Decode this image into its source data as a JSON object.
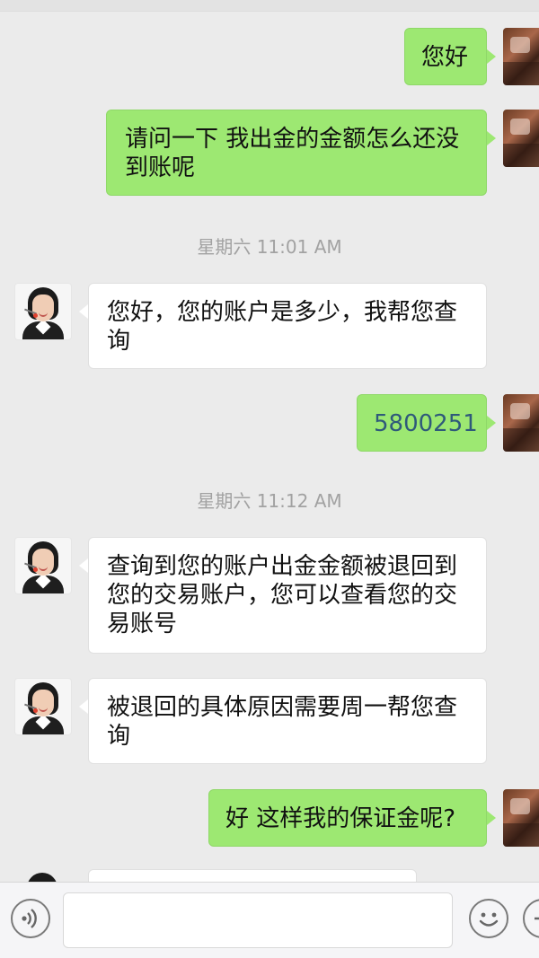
{
  "chat": {
    "messages": [
      {
        "from": "me",
        "text": "您好"
      },
      {
        "from": "me",
        "text": "请问一下 我出金的金额怎么还没到账呢"
      },
      {
        "type": "time",
        "text": "星期六 11:01 AM"
      },
      {
        "from": "agent",
        "text": "您好，您的账户是多少，我帮您查询"
      },
      {
        "from": "me",
        "text": "5800251"
      },
      {
        "type": "time",
        "text": "星期六 11:12 AM"
      },
      {
        "from": "agent",
        "text": "查询到您的账户出金金额被退回到您的交易账户，您可以查看您的交易账号"
      },
      {
        "from": "agent",
        "text": "被退回的具体原因需要周一帮您查询"
      },
      {
        "from": "me",
        "text": "好 这样我的保证金呢?"
      }
    ]
  },
  "input_bar": {
    "text_value": "",
    "icons": [
      "voice-icon",
      "emoji-icon",
      "plus-icon"
    ]
  },
  "colors": {
    "outgoing_bubble": "#9de872",
    "incoming_bubble": "#ffffff",
    "background": "#ebebeb",
    "timestamp_text": "#a2a2a2"
  }
}
